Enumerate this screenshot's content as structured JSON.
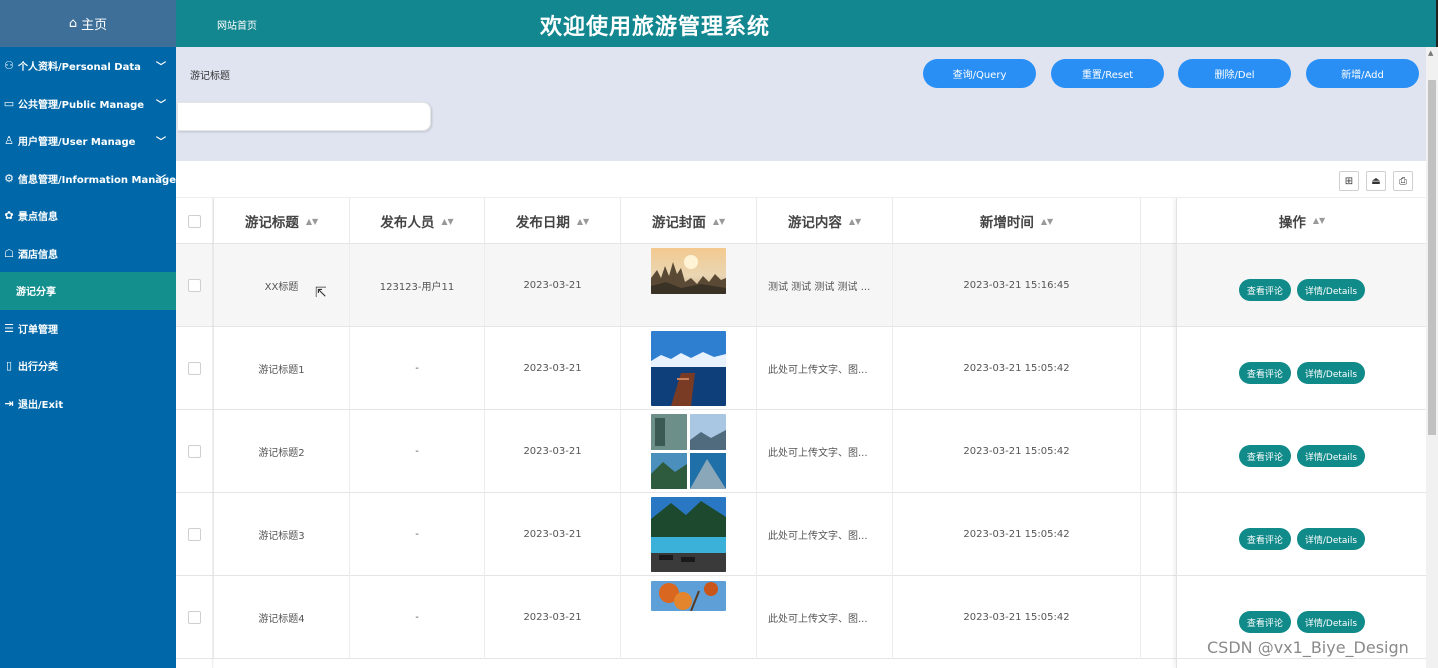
{
  "sidebar": {
    "home_label": "主页",
    "items": [
      {
        "label": "个人资料/Personal Data",
        "icon": "user-card-icon",
        "has_chevron": true
      },
      {
        "label": "公共管理/Public Manage",
        "icon": "monitor-icon",
        "has_chevron": true
      },
      {
        "label": "用户管理/User Manage",
        "icon": "person-icon",
        "has_chevron": true
      },
      {
        "label": "信息管理/Information Manage",
        "icon": "gear-icon",
        "has_chevron": true
      },
      {
        "label": "景点信息",
        "icon": "scenic-icon",
        "has_chevron": false
      },
      {
        "label": "酒店信息",
        "icon": "hotel-icon",
        "has_chevron": false
      },
      {
        "label": "游记分享",
        "icon": "",
        "has_chevron": false,
        "active": true
      },
      {
        "label": "订单管理",
        "icon": "order-icon",
        "has_chevron": false
      },
      {
        "label": "出行分类",
        "icon": "category-icon",
        "has_chevron": false
      },
      {
        "label": "退出/Exit",
        "icon": "exit-icon",
        "has_chevron": false
      }
    ]
  },
  "header": {
    "home_link": "网站首页",
    "title": "欢迎使用旅游管理系统"
  },
  "search": {
    "label": "游记标题",
    "input_value": "",
    "buttons": {
      "query": "查询/Query",
      "reset": "重置/Reset",
      "delete": "删除/Del",
      "add": "新增/Add"
    }
  },
  "toolbar": {
    "icons": [
      "columns-icon",
      "export-icon",
      "print-icon"
    ]
  },
  "table": {
    "columns": [
      "游记标题",
      "发布人员",
      "发布日期",
      "游记封面",
      "游记内容",
      "新增时间",
      "操作"
    ],
    "rows": [
      {
        "title": "XX标题",
        "publisher": "123123-用户11",
        "date": "2023-03-21",
        "cover": "mountain-sunset",
        "content": "测试 测试 测试 测试 ...",
        "created": "2023-03-21 15:16:45",
        "view_comments": "查看评论",
        "details": "详情/Details"
      },
      {
        "title": "游记标题1",
        "publisher": "-",
        "date": "2023-03-21",
        "cover": "lake-boat",
        "content": "此处可上传文字、图...",
        "created": "2023-03-21 15:05:42",
        "view_comments": "查看评论",
        "details": "详情/Details"
      },
      {
        "title": "游记标题2",
        "publisher": "-",
        "date": "2023-03-21",
        "cover": "collage",
        "content": "此处可上传文字、图...",
        "created": "2023-03-21 15:05:42",
        "view_comments": "查看评论",
        "details": "详情/Details"
      },
      {
        "title": "游记标题3",
        "publisher": "-",
        "date": "2023-03-21",
        "cover": "resort-pool",
        "content": "此处可上传文字、图...",
        "created": "2023-03-21 15:05:42",
        "view_comments": "查看评论",
        "details": "详情/Details"
      },
      {
        "title": "游记标题4",
        "publisher": "-",
        "date": "2023-03-21",
        "cover": "autumn-leaves",
        "content": "此处可上传文字、图...",
        "created": "2023-03-21 15:05:42",
        "view_comments": "查看评论",
        "details": "详情/Details"
      }
    ]
  },
  "watermark": "CSDN @vx1_Biye_Design",
  "colors": {
    "sidebar": "#0068a8",
    "header": "#13878f",
    "active_menu": "#138f8e",
    "primary_button": "#2a8ff5",
    "op_button": "#118a8a"
  }
}
